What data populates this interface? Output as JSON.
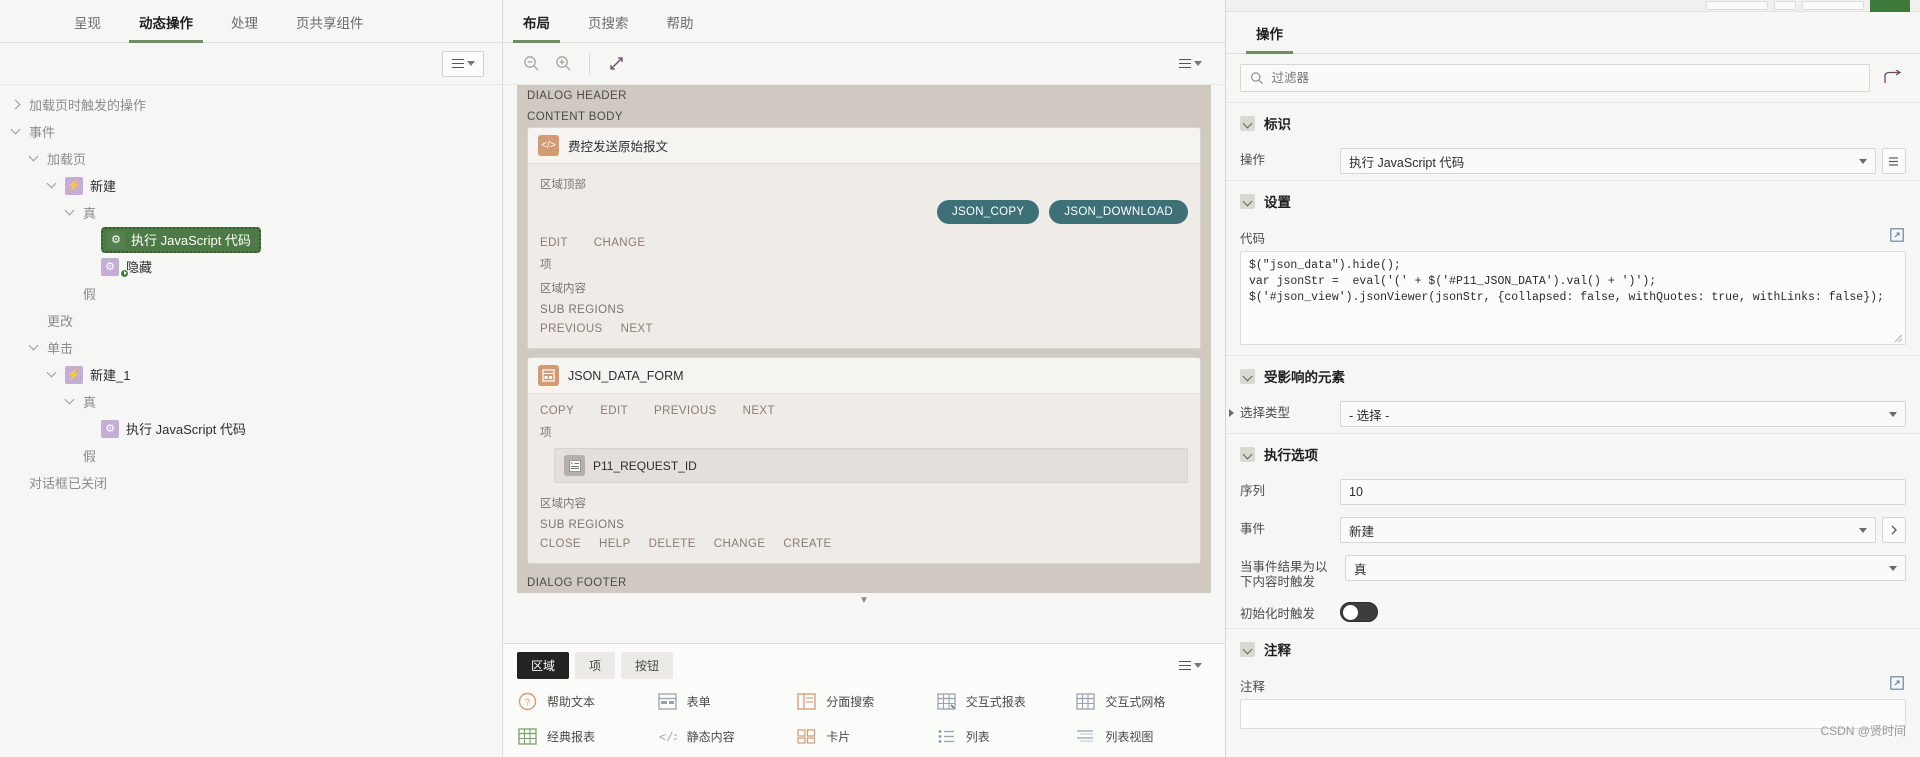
{
  "left": {
    "tabs": [
      {
        "label": "呈现",
        "active": false
      },
      {
        "label": "动态操作",
        "active": true
      },
      {
        "label": "处理",
        "active": false
      },
      {
        "label": "页共享组件",
        "active": false
      }
    ],
    "menu_button": "menu-icon",
    "tree": [
      {
        "label": "加载页时触发的操作",
        "indent": 0,
        "twist": "right",
        "icon": "",
        "dim": true
      },
      {
        "label": "事件",
        "indent": 0,
        "twist": "down",
        "icon": "",
        "dim": true
      },
      {
        "label": "加载页",
        "indent": 1,
        "twist": "down",
        "icon": "",
        "dim": true
      },
      {
        "label": "新建",
        "indent": 2,
        "twist": "down",
        "icon": "bolt",
        "dim": false
      },
      {
        "label": "真",
        "indent": 3,
        "twist": "down",
        "icon": "",
        "dim": true
      },
      {
        "label": "执行 JavaScript 代码",
        "indent": 4,
        "twist": "none",
        "icon": "gear-w",
        "selected": true
      },
      {
        "label": "隐藏",
        "indent": 4,
        "twist": "none",
        "icon": "gear",
        "badge": true
      },
      {
        "label": "假",
        "indent": 3,
        "twist": "none",
        "icon": "",
        "dim": true
      },
      {
        "label": "更改",
        "indent": 1,
        "twist": "none",
        "icon": "",
        "dim": true
      },
      {
        "label": "单击",
        "indent": 1,
        "twist": "down",
        "icon": "",
        "dim": true
      },
      {
        "label": "新建_1",
        "indent": 2,
        "twist": "down",
        "icon": "bolt",
        "dim": false
      },
      {
        "label": "真",
        "indent": 3,
        "twist": "down",
        "icon": "",
        "dim": true
      },
      {
        "label": "执行 JavaScript 代码",
        "indent": 4,
        "twist": "none",
        "icon": "gear",
        "dim": false
      },
      {
        "label": "假",
        "indent": 3,
        "twist": "none",
        "icon": "",
        "dim": true
      },
      {
        "label": "对话框已关闭",
        "indent": 0,
        "twist": "none",
        "icon": "",
        "dim": true
      }
    ]
  },
  "center": {
    "tabs": [
      {
        "label": "布局",
        "active": true
      },
      {
        "label": "页搜索",
        "active": false
      },
      {
        "label": "帮助",
        "active": false
      }
    ],
    "toolbar": {
      "zoom_out": "zoom-out-icon",
      "zoom_in": "zoom-in-icon",
      "expand": "expand-icon",
      "menu": "menu-icon"
    },
    "dialog_header": "DIALOG HEADER",
    "content_body": "CONTENT BODY",
    "dialog_footer": "DIALOG FOOTER",
    "regions": [
      {
        "name": "费控发送原始报文",
        "icon": "code-region-icon",
        "top_label": "区域顶部",
        "buttons": [
          "JSON_COPY",
          "JSON_DOWNLOAD"
        ],
        "links1": [
          "EDIT",
          "CHANGE"
        ],
        "items_label": "项",
        "content_label": "区域内容",
        "sub_regions_label": "SUB REGIONS",
        "links2": [
          "PREVIOUS",
          "NEXT"
        ]
      },
      {
        "name": "JSON_DATA_FORM",
        "icon": "form-region-icon",
        "links1": [
          "COPY",
          "EDIT",
          "PREVIOUS",
          "NEXT"
        ],
        "items_label": "项",
        "items": [
          {
            "name": "P11_REQUEST_ID",
            "icon": "text-item-icon"
          }
        ],
        "content_label": "区域内容",
        "sub_regions_label": "SUB REGIONS",
        "links2": [
          "CLOSE",
          "HELP",
          "DELETE",
          "CHANGE",
          "CREATE"
        ]
      }
    ],
    "gallery": {
      "tabs": [
        {
          "label": "区域",
          "active": true
        },
        {
          "label": "项",
          "active": false
        },
        {
          "label": "按钮",
          "active": false
        }
      ],
      "menu": "menu-icon",
      "items": [
        {
          "label": "帮助文本",
          "icon": "help-text-icon"
        },
        {
          "label": "表单",
          "icon": "form-icon"
        },
        {
          "label": "分面搜索",
          "icon": "faceted-search-icon"
        },
        {
          "label": "交互式报表",
          "icon": "interactive-report-icon"
        },
        {
          "label": "交互式网格",
          "icon": "interactive-grid-icon"
        },
        {
          "label": "经典报表",
          "icon": "classic-report-icon"
        },
        {
          "label": "静态内容",
          "icon": "static-content-icon"
        },
        {
          "label": "卡片",
          "icon": "cards-icon"
        },
        {
          "label": "列表",
          "icon": "list-icon"
        },
        {
          "label": "列表视图",
          "icon": "list-view-icon"
        }
      ]
    }
  },
  "right": {
    "tabs": [
      {
        "label": "操作",
        "active": true
      }
    ],
    "search": {
      "placeholder": "过滤器",
      "value": "",
      "icon": "search-icon"
    },
    "redo_icon": "redo-icon",
    "sections": [
      {
        "title": "标识",
        "fields": [
          {
            "label": "操作",
            "type": "select",
            "value": "执行 JavaScript 代码",
            "button": "list-icon"
          }
        ]
      },
      {
        "title": "设置",
        "code_label": "代码",
        "code": "$(\"json_data\").hide();\nvar jsonStr =  eval('(' + $('#P11_JSON_DATA').val() + ')');\n$('#json_view').jsonViewer(jsonStr, {collapsed: false, withQuotes: true, withLinks: false});",
        "expand_icon": "expand-code-icon"
      },
      {
        "title": "受影响的元素",
        "fields": [
          {
            "label": "选择类型",
            "type": "select",
            "value": "- 选择 -"
          }
        ]
      },
      {
        "title": "执行选项",
        "fields": [
          {
            "label": "序列",
            "type": "text",
            "value": "10"
          },
          {
            "label": "事件",
            "type": "select",
            "value": "新建",
            "button": "chevron-right-icon"
          },
          {
            "label": "当事件结果为以下内容时触发",
            "type": "select",
            "value": "真"
          },
          {
            "label": "初始化时触发",
            "type": "toggle",
            "value": "off"
          }
        ]
      },
      {
        "title": "注释",
        "note_label": "注释",
        "expand_icon": "expand-note-icon"
      }
    ]
  },
  "watermark": "CSDN @贤时间",
  "colors": {
    "accent_green": "#6e8b62",
    "selection_green": "#4d7a46",
    "pill_teal": "#3e7078",
    "region_icon": "#d49a72",
    "tree_icon": "#c4aed6"
  }
}
